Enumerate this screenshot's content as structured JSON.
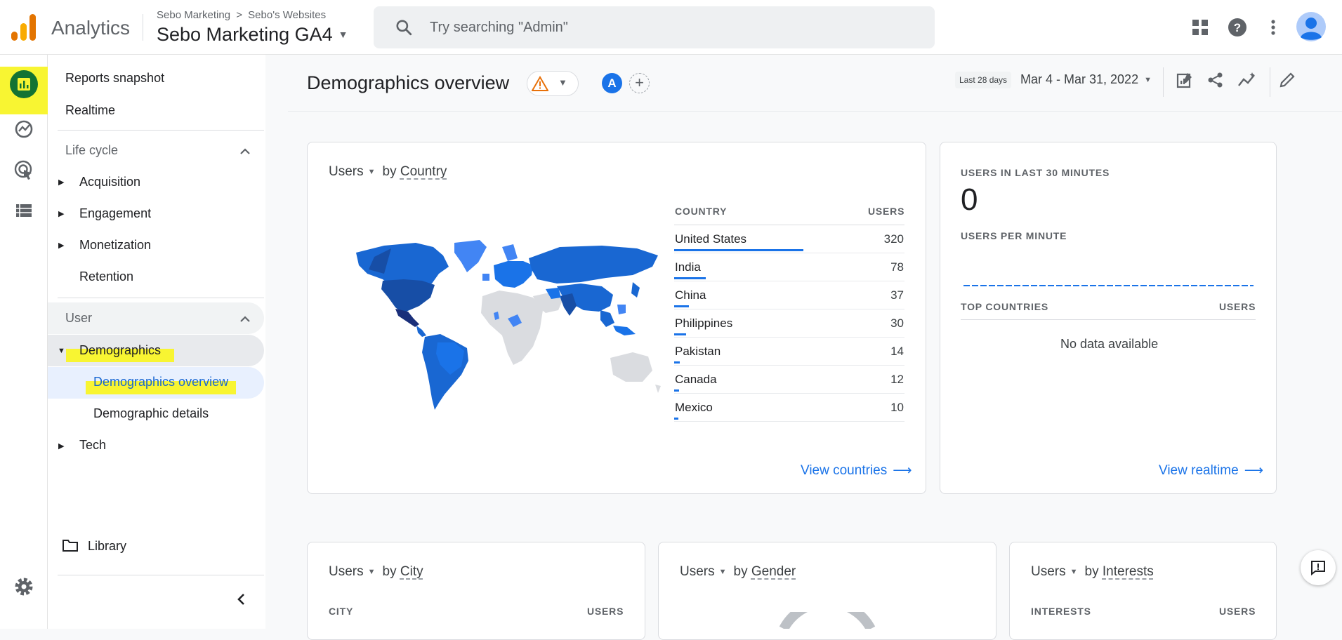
{
  "app": {
    "name": "Analytics"
  },
  "header": {
    "account": "Sebo Marketing",
    "crumb_sep": ">",
    "property_group": "Sebo's Websites",
    "property": "Sebo Marketing GA4",
    "search_placeholder": "Try searching \"Admin\""
  },
  "nav": {
    "reports_snapshot": "Reports snapshot",
    "realtime": "Realtime",
    "lifecycle": "Life cycle",
    "acquisition": "Acquisition",
    "engagement": "Engagement",
    "monetization": "Monetization",
    "retention": "Retention",
    "user": "User",
    "demographics": "Demographics",
    "demographics_overview": "Demographics overview",
    "demographic_details": "Demographic details",
    "tech": "Tech",
    "library": "Library"
  },
  "page": {
    "title": "Demographics overview",
    "comparison_avatar": "A",
    "date_caption": "Last 28 days",
    "date_range": "Mar 4 - Mar 31, 2022"
  },
  "country_card": {
    "metric": "Users",
    "by": "by",
    "dimension": "Country",
    "col_dimension": "COUNTRY",
    "col_metric": "USERS",
    "rows": [
      {
        "country": "United States",
        "users": "320",
        "share": 1.0
      },
      {
        "country": "India",
        "users": "78",
        "share": 0.244
      },
      {
        "country": "China",
        "users": "37",
        "share": 0.116
      },
      {
        "country": "Philippines",
        "users": "30",
        "share": 0.094
      },
      {
        "country": "Pakistan",
        "users": "14",
        "share": 0.044
      },
      {
        "country": "Canada",
        "users": "12",
        "share": 0.038
      },
      {
        "country": "Mexico",
        "users": "10",
        "share": 0.031
      }
    ],
    "link": "View countries"
  },
  "realtime_card": {
    "users_label": "USERS IN LAST 30 MINUTES",
    "users_value": "0",
    "per_minute_label": "USERS PER MINUTE",
    "top_countries_label": "TOP COUNTRIES",
    "users_col": "USERS",
    "empty": "No data available",
    "link": "View realtime"
  },
  "city_card": {
    "metric": "Users",
    "by": "by",
    "dimension": "City",
    "col_dimension": "CITY",
    "col_metric": "USERS"
  },
  "gender_card": {
    "metric": "Users",
    "by": "by",
    "dimension": "Gender"
  },
  "interests_card": {
    "metric": "Users",
    "by": "by",
    "dimension": "Interests",
    "col_dimension": "INTERESTS",
    "col_metric": "USERS"
  },
  "colors": {
    "accent": "#1a73e8",
    "highlight": "#f8f532",
    "map_dark": "#174ea6",
    "map_mid": "#1967d2",
    "map_light": "#4285f4",
    "map_none": "#dadce0"
  }
}
